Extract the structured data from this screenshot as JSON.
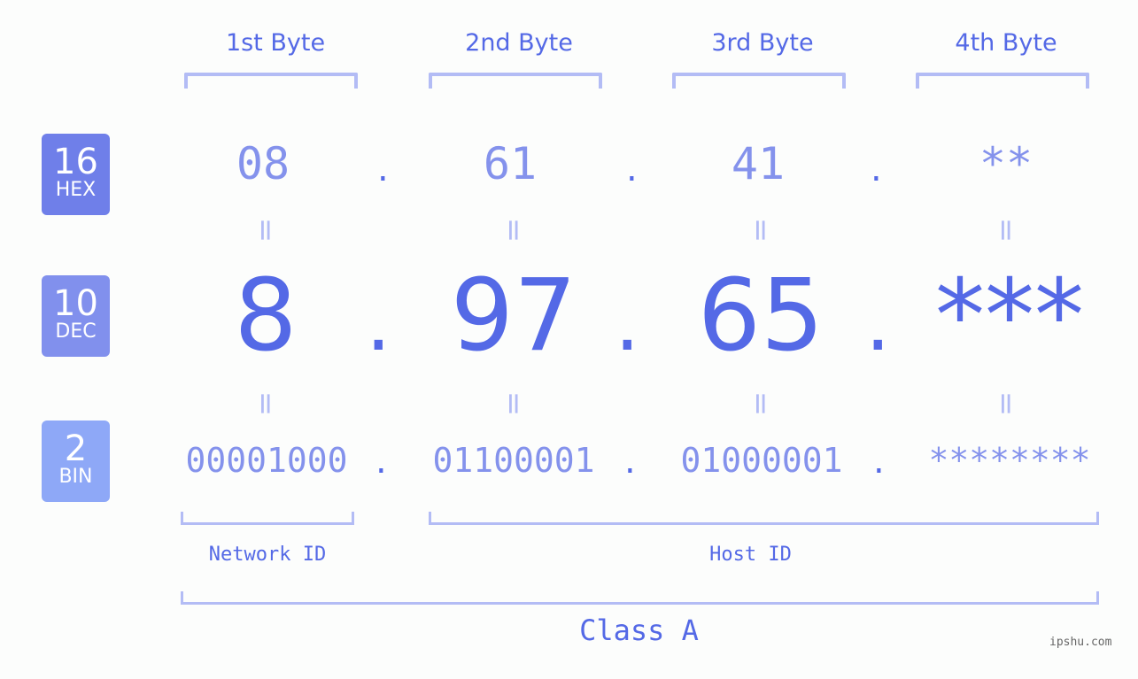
{
  "bytes": [
    {
      "header": "1st Byte",
      "hex": "08",
      "dec": "8",
      "bin": "00001000"
    },
    {
      "header": "2nd Byte",
      "hex": "61",
      "dec": "97",
      "bin": "01100001"
    },
    {
      "header": "3rd Byte",
      "hex": "41",
      "dec": "65",
      "bin": "01000001"
    },
    {
      "header": "4th Byte",
      "hex": "**",
      "dec": "***",
      "bin": "********"
    }
  ],
  "badges": [
    {
      "base": "16",
      "label": "HEX",
      "color": "#6f7fe9"
    },
    {
      "base": "10",
      "label": "DEC",
      "color": "#8190ed"
    },
    {
      "base": "2",
      "label": "BIN",
      "color": "#8ea8f7"
    }
  ],
  "separator": ".",
  "equals": "=",
  "network_id_label": "Network ID",
  "host_id_label": "Host ID",
  "class_label": "Class A",
  "footer": "ipshu.com",
  "colors": {
    "accent": "#5469e6",
    "light": "#8492ec",
    "bracket": "#b3bcf5"
  }
}
